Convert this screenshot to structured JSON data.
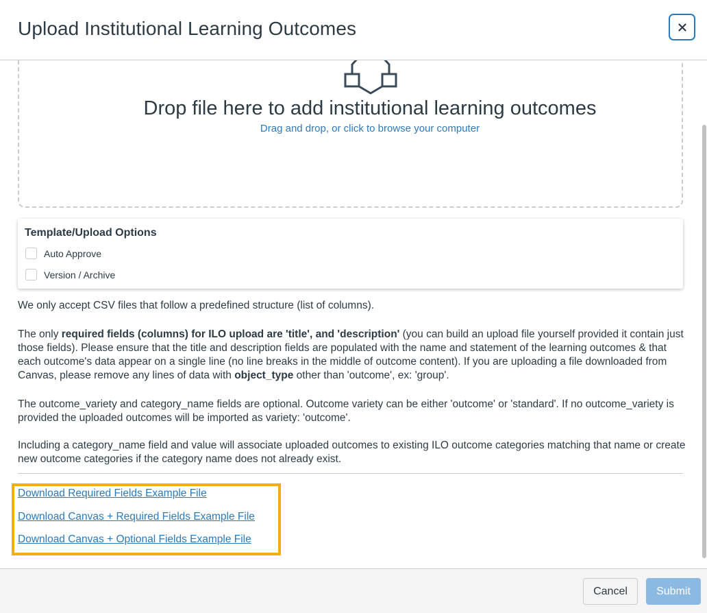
{
  "modal": {
    "title": "Upload Institutional Learning Outcomes",
    "close_label": "×"
  },
  "dropzone": {
    "icon": "upload-icon",
    "heading": "Drop file here to add institutional learning outcomes",
    "subtext": "Drag and drop, or click to browse your computer"
  },
  "options": {
    "title": "Template/Upload Options",
    "items": [
      {
        "label": "Auto Approve",
        "checked": false
      },
      {
        "label": "Version / Archive",
        "checked": false
      }
    ]
  },
  "info": {
    "p1": "We only accept CSV files that follow a predefined structure (list of columns).",
    "p2_a": "The only ",
    "p2_bold1": "required fields (columns) for ILO upload are 'title', and 'description'",
    "p2_b": " (you can build an upload file yourself provided it contain just those fields). Please ensure that the title and description fields are populated with the name and statement of the learning outcomes & that each outcome's data appear on a single line (no line breaks in the middle of outcome content). If you are uploading a file downloaded from Canvas, please remove any lines of data with ",
    "p2_bold2": "object_type",
    "p2_c": " other than 'outcome', ex: 'group'.",
    "p3": "The outcome_variety and category_name fields are optional. Outcome variety can be either 'outcome' or 'standard'. If no outcome_variety is provided the uploaded outcomes will be imported as variety: 'outcome'.",
    "p4": "Including a category_name field and value will associate uploaded outcomes to existing ILO outcome categories matching that name or create new outcome categories if the category name does not already exist."
  },
  "downloads": [
    "Download Required Fields Example File",
    "Download Canvas + Required Fields Example File",
    "Download Canvas + Optional Fields Example File"
  ],
  "footer": {
    "cancel_label": "Cancel",
    "submit_label": "Submit"
  },
  "colors": {
    "link": "#2b7abc",
    "highlight": "#f6ad15",
    "submit_disabled": "#8cb9e1"
  }
}
